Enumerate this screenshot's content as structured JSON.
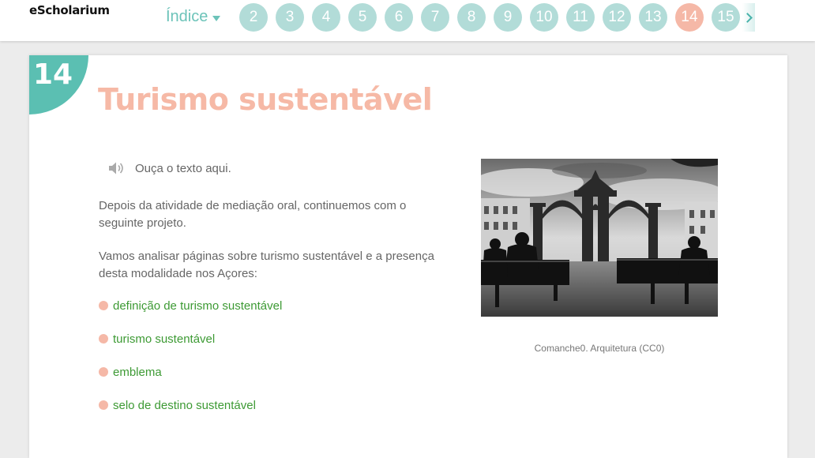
{
  "header": {
    "logo": "eScholarium",
    "index_label": "Índice",
    "pages": [
      "2",
      "3",
      "4",
      "5",
      "6",
      "7",
      "8",
      "9",
      "10",
      "11",
      "12",
      "13",
      "14",
      "15"
    ],
    "active_page": "14"
  },
  "section": {
    "number": "14",
    "title": "Turismo sustentável"
  },
  "audio": {
    "label": "Ouça o texto aqui."
  },
  "body": {
    "paragraph1": "Depois da atividade de mediação oral, continuemos com o seguinte projeto.",
    "paragraph2": "Vamos analisar páginas sobre turismo sustentável e a presença desta modalidade nos Açores:"
  },
  "links": [
    "definição de turismo sustentável",
    "turismo sustentável",
    "emblema",
    "selo de destino sustentável"
  ],
  "image": {
    "caption": "Comanche0. Arquitetura (CC0)"
  },
  "colors": {
    "accent": "#5bbfb2",
    "page_bubble": "#b2dcd8",
    "active_page": "#f5b8a7",
    "title": "#f6b9a6",
    "link": "#3d9a34"
  }
}
